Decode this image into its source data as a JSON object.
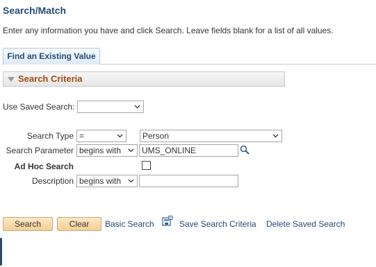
{
  "page": {
    "title": "Search/Match",
    "instructions": "Enter any information you have and click Search. Leave fields blank for a list of all values."
  },
  "tabs": [
    {
      "label": "Find an Existing Value"
    }
  ],
  "search_criteria": {
    "header": "Search Criteria",
    "saved_search": {
      "label": "Use Saved Search:",
      "value": ""
    },
    "search_type": {
      "label": "Search Type",
      "operator": "=",
      "value": "Person"
    },
    "search_parameter": {
      "label": "Search Parameter",
      "operator": "begins with",
      "value": "UMS_ONLINE"
    },
    "ad_hoc_search": {
      "label": "Ad Hoc Search",
      "checked": false
    },
    "description": {
      "label": "Description",
      "operator": "begins with",
      "value": ""
    }
  },
  "actions": {
    "search_label": "Search",
    "clear_label": "Clear",
    "basic_search_label": "Basic Search",
    "save_search_criteria_label": "Save Search Criteria",
    "delete_saved_search_label": "Delete Saved Search"
  },
  "icons": {
    "lookup": "magnifier-icon",
    "save_search": "save-search-icon",
    "group_collapse": "collapse-arrow-icon",
    "dropdown": "chevron-down-icon"
  },
  "colors": {
    "title": "#204c7a",
    "group_header_text": "#a24b16",
    "link": "#204c7a",
    "button_fill": "#f6cf95"
  }
}
